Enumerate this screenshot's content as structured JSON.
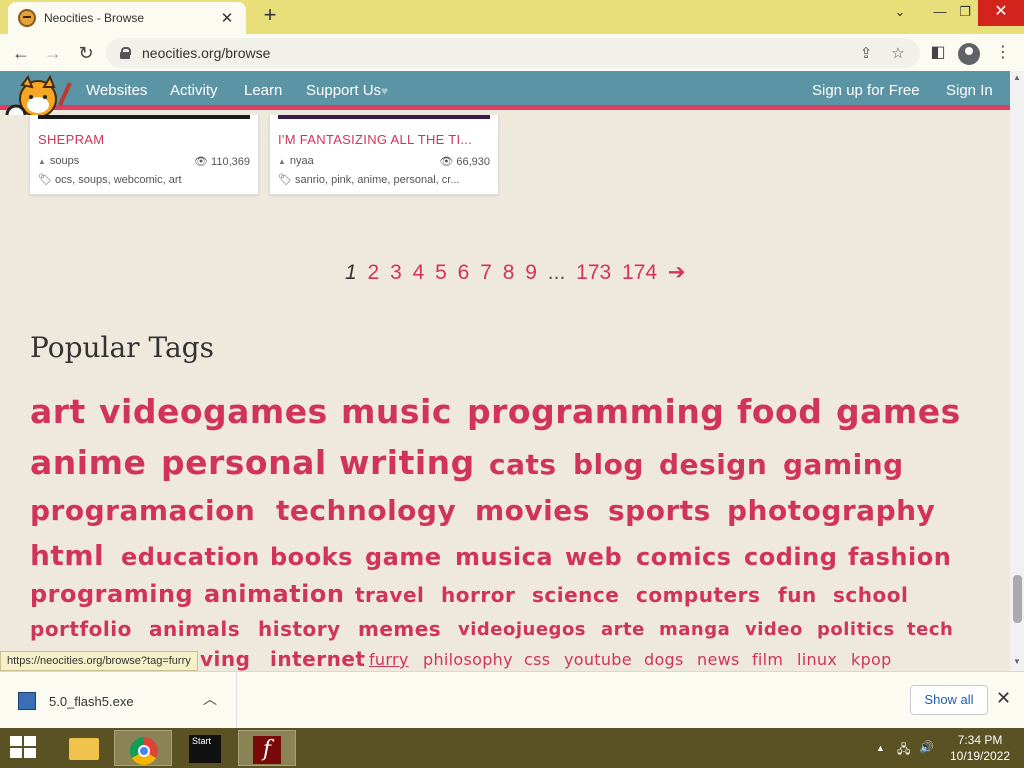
{
  "browser": {
    "tab_title": "Neocities - Browse",
    "url": "neocities.org/browse",
    "status_url": "https://neocities.org/browse?tag=furry"
  },
  "site_nav": {
    "items": [
      "Websites",
      "Activity",
      "Learn",
      "Support Us"
    ],
    "signup": "Sign up for Free",
    "signin": "Sign In"
  },
  "cards": [
    {
      "title": "SHEPRAM",
      "user": "soups",
      "views": "110,369",
      "tags": "ocs, soups, webcomic, art"
    },
    {
      "title": "I'M FANTASIZING ALL THE TI...",
      "user": "nyaa",
      "views": "66,930",
      "tags": "sanrio, pink, anime, personal, cr..."
    }
  ],
  "pagination": {
    "current": "1",
    "pages": [
      "2",
      "3",
      "4",
      "5",
      "6",
      "7",
      "8",
      "9"
    ],
    "ellipsis": "...",
    "last_pages": [
      "173",
      "174"
    ]
  },
  "popular_tags": {
    "heading": "Popular Tags",
    "rows": [
      [
        "art",
        "videogames",
        "music",
        "programming",
        "food",
        "games"
      ],
      [
        "anime",
        "personal",
        "writing",
        "cats",
        "blog",
        "design",
        "gaming"
      ],
      [
        "programacion",
        "technology",
        "movies",
        "sports",
        "photography"
      ],
      [
        "html",
        "education",
        "books",
        "game",
        "musica",
        "web",
        "comics",
        "coding",
        "fashion"
      ],
      [
        "programing",
        "animation",
        "travel",
        "horror",
        "science",
        "computers",
        "fun",
        "school"
      ],
      [
        "portfolio",
        "animals",
        "history",
        "memes",
        "videojuegos",
        "arte",
        "manga",
        "video",
        "politics",
        "tech"
      ],
      [
        "ving",
        "internet",
        "furry",
        "philosophy",
        "css",
        "youtube",
        "dogs",
        "news",
        "film",
        "linux",
        "kpop"
      ]
    ]
  },
  "downloads": {
    "file": "5.0_flash5.exe",
    "show_all": "Show all"
  },
  "taskbar": {
    "console_label": "Start",
    "time": "7:34 PM",
    "date": "10/19/2022"
  },
  "colors": {
    "accent": "#d13459",
    "header": "#5b94a5",
    "background": "#efe8dc"
  }
}
